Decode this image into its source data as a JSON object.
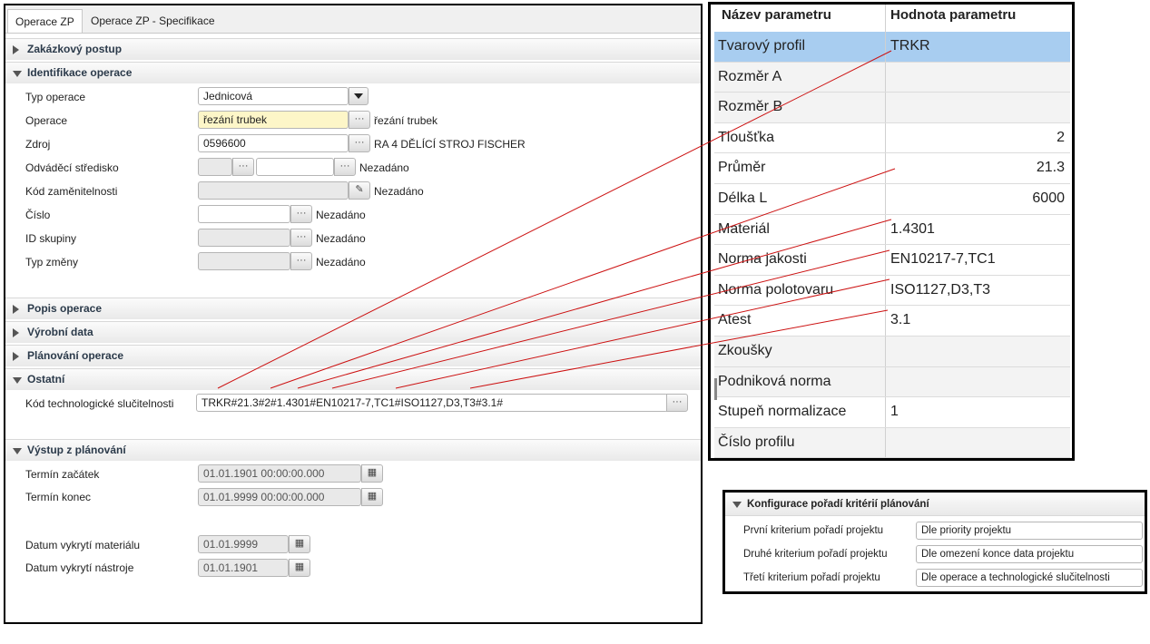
{
  "tabs": [
    "Operace ZP",
    "Operace ZP - Specifikace"
  ],
  "sections": {
    "zakazkovy_postup": "Zakázkový postup",
    "identifikace": "Identifikace operace",
    "popis": "Popis operace",
    "vyrobni": "Výrobní data",
    "planovani": "Plánování operace",
    "ostatni": "Ostatní",
    "vystup": "Výstup z plánování"
  },
  "identifikace": {
    "typ_operace": {
      "label": "Typ operace",
      "value": "Jednicová"
    },
    "operace": {
      "label": "Operace",
      "value": "řezání trubek",
      "note": "řezání trubek"
    },
    "zdroj": {
      "label": "Zdroj",
      "value": "0596600",
      "note": "RA 4 DĚLÍCÍ STROJ FISCHER"
    },
    "odvadeci": {
      "label": "Odváděcí středisko",
      "value1": "",
      "value2": "",
      "note": "Nezadáno"
    },
    "kod_zamenitelnosti": {
      "label": "Kód zaměnitelnosti",
      "value": "",
      "note": "Nezadáno"
    },
    "cislo": {
      "label": "Číslo",
      "value": "",
      "note": "Nezadáno"
    },
    "id_skupiny": {
      "label": "ID skupiny",
      "value": "",
      "note": "Nezadáno"
    },
    "typ_zmeny": {
      "label": "Typ změny",
      "value": "",
      "note": "Nezadáno"
    }
  },
  "ostatni": {
    "kod_label": "Kód technologické slučitelnosti",
    "kod_value": "TRKR#21.3#2#1.4301#EN10217-7,TC1#ISO1127,D3,T3#3.1#"
  },
  "vystup": {
    "termin_zacatek": {
      "label": "Termín začátek",
      "value": "01.01.1901 00:00:00.000"
    },
    "termin_konec": {
      "label": "Termín konec",
      "value": "01.01.9999 00:00:00.000"
    },
    "datum_material": {
      "label": "Datum vykrytí materiálu",
      "value": "01.01.9999"
    },
    "datum_nastroje": {
      "label": "Datum vykrytí nástroje",
      "value": "01.01.1901"
    }
  },
  "params": {
    "header_name": "Název parametru",
    "header_value": "Hodnota parametru",
    "rows": [
      {
        "name": "Tvarový profil",
        "value": "TRKR"
      },
      {
        "name": "Rozměr A",
        "value": ""
      },
      {
        "name": "Rozměr B",
        "value": ""
      },
      {
        "name": "Tloušťka",
        "value": "2"
      },
      {
        "name": "Průměr",
        "value": "21.3"
      },
      {
        "name": "Délka L",
        "value": "6000"
      },
      {
        "name": "Materiál",
        "value": "1.4301"
      },
      {
        "name": "Norma jakosti",
        "value": "EN10217-7,TC1"
      },
      {
        "name": "Norma polotovaru",
        "value": "ISO1127,D3,T3"
      },
      {
        "name": "Atest",
        "value": "3.1"
      },
      {
        "name": "Zkoušky",
        "value": ""
      },
      {
        "name": "Podniková norma",
        "value": ""
      },
      {
        "name": "Stupeň normalizace",
        "value": "1"
      },
      {
        "name": "Číslo profilu",
        "value": ""
      }
    ],
    "selected_row_color": "#a8cdf0"
  },
  "config": {
    "title": "Konfigurace pořadí kritérií plánování",
    "rows": [
      {
        "label": "První kriterium pořadí projektu",
        "value": "Dle priority projektu"
      },
      {
        "label": "Druhé kriterium pořadí projektu",
        "value": "Dle omezení konce data projektu"
      },
      {
        "label": "Třetí kriterium pořadí projektu",
        "value": "Dle operace a technologické slučitelnosti"
      }
    ]
  },
  "colors": {
    "connector": "#cc1111",
    "operace_highlight": "#fdf6c8"
  }
}
